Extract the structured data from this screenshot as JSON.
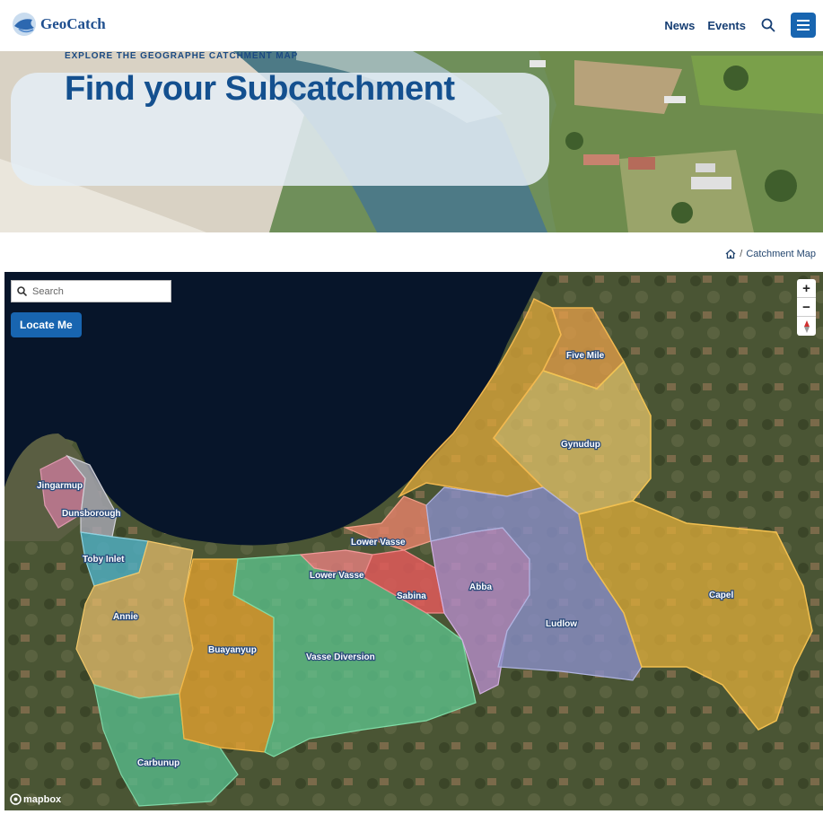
{
  "header": {
    "logo_text": "GeoCatch",
    "nav": [
      "News",
      "Events"
    ]
  },
  "icons": {
    "logo": "fish-drop-logo-icon",
    "search": "search-icon",
    "menu": "hamburger-menu-icon",
    "home": "home-icon",
    "map_search": "search-icon",
    "compass": "compass-icon"
  },
  "hero": {
    "eyebrow": "EXPLORE THE GEOGRAPHE CATCHMENT MAP",
    "title": "Find your Subcatchment"
  },
  "breadcrumb": {
    "separator": "/",
    "current": "Catchment Map"
  },
  "map": {
    "search_placeholder": "Search",
    "locate_label": "Locate Me",
    "zoom_in": "+",
    "zoom_out": "−",
    "attribution": "mapbox",
    "regions": [
      {
        "name": "Five Mile",
        "color": "#e8a04a"
      },
      {
        "name": "Gynudup",
        "color": "#e6c46a"
      },
      {
        "name": "Jingarmup",
        "color": "#c97a9a"
      },
      {
        "name": "Dunsborough",
        "color": "#a8a8b4"
      },
      {
        "name": "Toby Inlet",
        "color": "#4fb0c6"
      },
      {
        "name": "Lower Vasse",
        "color": "#e8826a"
      },
      {
        "name": "Lower Vasse",
        "color": "#e77f7f"
      },
      {
        "name": "Sabina",
        "color": "#e05a5a"
      },
      {
        "name": "Abba",
        "color": "#b58cc9"
      },
      {
        "name": "Ludlow",
        "color": "#8a8fc8"
      },
      {
        "name": "Capel",
        "color": "#e0ae3a"
      },
      {
        "name": "Annie",
        "color": "#e3bb6a"
      },
      {
        "name": "Buayanyup",
        "color": "#e0a030"
      },
      {
        "name": "Vasse Diversion",
        "color": "#5cbf8a"
      },
      {
        "name": "Carbunup",
        "color": "#56b98a"
      }
    ]
  }
}
